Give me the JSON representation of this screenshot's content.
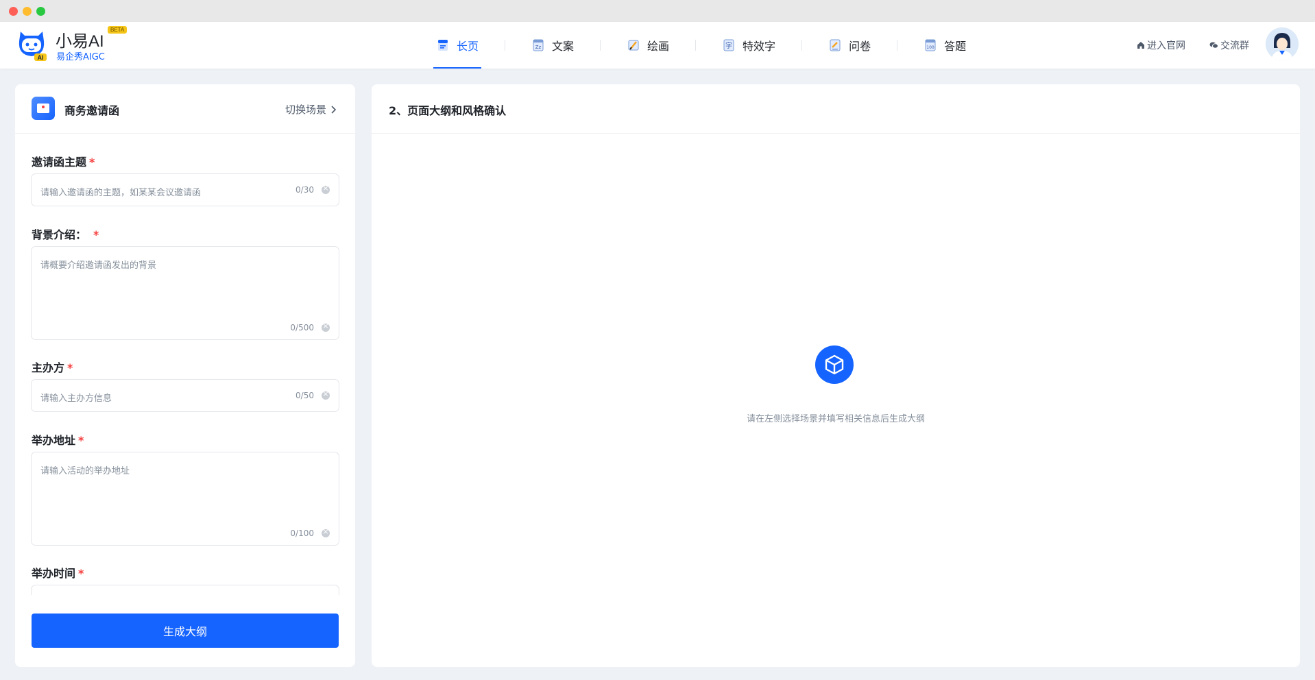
{
  "brand": {
    "name": "小易AI",
    "badge": "BETA",
    "subtitle": "易企秀AIGC",
    "logo_badge": "AI"
  },
  "nav": [
    {
      "label": "长页",
      "icon": "long-page-icon",
      "active": true
    },
    {
      "label": "文案",
      "icon": "copywriting-icon",
      "active": false
    },
    {
      "label": "绘画",
      "icon": "painting-icon",
      "active": false
    },
    {
      "label": "特效字",
      "icon": "effect-text-icon",
      "active": false
    },
    {
      "label": "问卷",
      "icon": "survey-icon",
      "active": false
    },
    {
      "label": "答题",
      "icon": "quiz-icon",
      "active": false
    }
  ],
  "header_links": {
    "website": "进入官网",
    "group": "交流群"
  },
  "left_panel": {
    "scene_title": "商务邀请函",
    "switch_label": "切换场景",
    "fields": [
      {
        "label": "邀请函主题",
        "placeholder": "请输入邀请函的主题，如某某会议邀请函",
        "count": "0/30"
      },
      {
        "label": "背景介绍：",
        "placeholder": "请概要介绍邀请函发出的背景",
        "count": "0/500"
      },
      {
        "label": "主办方",
        "placeholder": "请输入主办方信息",
        "count": "0/50"
      },
      {
        "label": "举办地址",
        "placeholder": "请输入活动的举办地址",
        "count": "0/100"
      },
      {
        "label": "举办时间",
        "placeholder": "",
        "count": ""
      }
    ],
    "required_mark": "*",
    "generate_button": "生成大纲"
  },
  "right_panel": {
    "title": "2、页面大纲和风格确认",
    "empty_text": "请在左侧选择场景并填写相关信息后生成大纲"
  },
  "colors": {
    "primary": "#1664ff",
    "required": "#f53f3f",
    "background": "#eef1f5"
  }
}
